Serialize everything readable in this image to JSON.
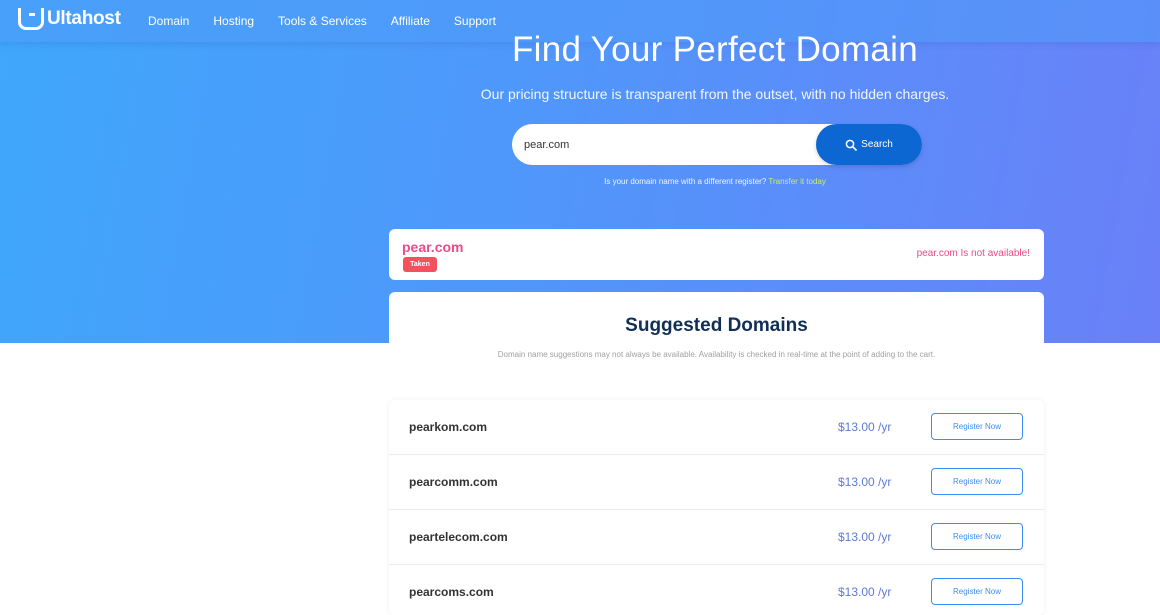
{
  "nav": {
    "logo_text": "Ultahost",
    "links": [
      "Domain",
      "Hosting",
      "Tools & Services",
      "Affiliate",
      "Support"
    ]
  },
  "hero": {
    "title": "Find Your Perfect Domain",
    "subtitle": "Our pricing structure is transparent from the outset, with no hidden charges."
  },
  "search": {
    "value": "pear.com",
    "button_label": "Search",
    "transfer_text": "Is your domain name with a different register?",
    "transfer_link": "Transfer it today"
  },
  "result": {
    "domain": "pear.com",
    "badge": "Taken",
    "status": "pear.com Is not available!"
  },
  "suggestions": {
    "title": "Suggested Domains",
    "note": "Domain name suggestions may not always be available. Availability is checked in real-time at the point of adding to the cart.",
    "items": [
      {
        "domain": "pearkom.com",
        "price": "$13.00 /yr",
        "button": "Register Now"
      },
      {
        "domain": "pearcomm.com",
        "price": "$13.00 /yr",
        "button": "Register Now"
      },
      {
        "domain": "peartelecom.com",
        "price": "$13.00 /yr",
        "button": "Register Now"
      },
      {
        "domain": "pearcoms.com",
        "price": "$13.00 /yr",
        "button": "Register Now"
      }
    ]
  },
  "colors": {
    "accent": "#0c67d3",
    "taken": "#ec4b87",
    "price": "#5d7ad5",
    "title": "#112f55"
  }
}
